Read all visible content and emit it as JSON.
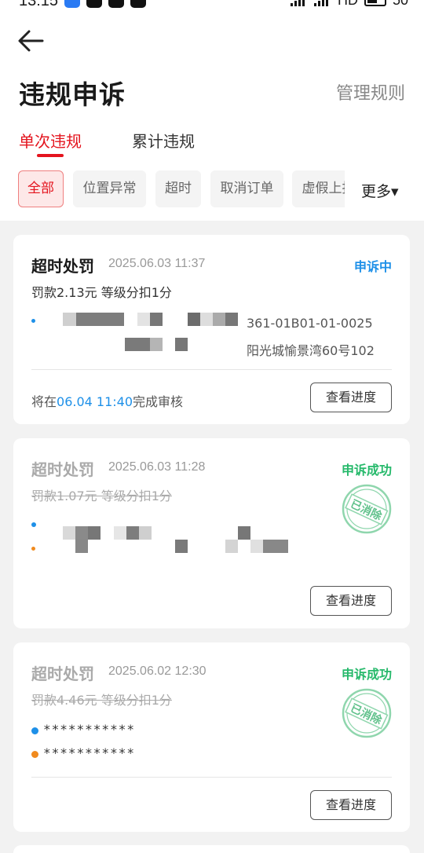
{
  "status_bar": {
    "time": "13:15",
    "network": "HD",
    "battery": "50"
  },
  "header": {
    "title": "违规申诉",
    "manage_link": "管理规则"
  },
  "tabs": [
    {
      "label": "单次违规",
      "active": true
    },
    {
      "label": "累计违规",
      "active": false
    }
  ],
  "filters": [
    {
      "label": "全部",
      "active": true
    },
    {
      "label": "位置异常"
    },
    {
      "label": "超时"
    },
    {
      "label": "取消订单"
    },
    {
      "label": "虚假上报"
    }
  ],
  "more_filter": "更多▾",
  "cards": [
    {
      "title": "超时处罚",
      "time": "2025.06.03 11:37",
      "status": "申诉中",
      "fine": "罚款2.13元 等级分扣1分",
      "addr_tail_1": "361-01B01-01-0025",
      "addr_tail_2": "阳光城愉景湾60号102",
      "review_prefix": "将在",
      "review_time": "06.04 11:40",
      "review_suffix": "完成审核",
      "button": "查看进度"
    },
    {
      "title": "超时处罚",
      "time": "2025.06.03 11:28",
      "status": "申诉成功",
      "fine": "罚款1.07元 等级分扣1分",
      "stamp": "已消除",
      "button": "查看进度"
    },
    {
      "title": "超时处罚",
      "time": "2025.06.02 12:30",
      "status": "申诉成功",
      "fine": "罚款4.46元 等级分扣1分",
      "stamp": "已消除",
      "masked_1": "***********",
      "masked_2": "***********",
      "button": "查看进度"
    }
  ],
  "colors": {
    "accent_red": "#e4141e",
    "link_blue": "#1e90e8",
    "success_green": "#26b96b"
  },
  "icons": [
    "back-arrow-icon",
    "seal-stamp-icon",
    "location-dot-icon"
  ]
}
